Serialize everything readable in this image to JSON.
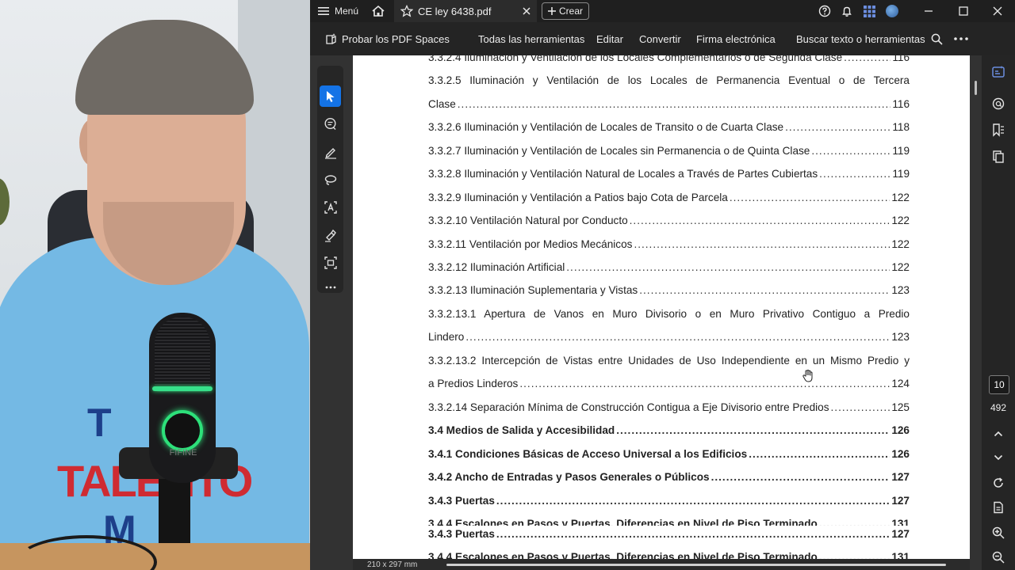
{
  "titlebar": {
    "menu_label": "Menú",
    "tab_title": "CE ley 6438.pdf",
    "create_label": "Crear"
  },
  "toolbar": {
    "spaces_label": "Probar los PDF Spaces",
    "all_tools_label": "Todas las herramientas",
    "edit_label": "Editar",
    "convert_label": "Convertir",
    "sign_label": "Firma electrónica",
    "search_label": "Buscar texto o herramientas"
  },
  "document": {
    "page_size": "210 x 297 mm",
    "toc": [
      {
        "text": "3.3.2.4 Iluminación y Ventilación de los Locales Complementarios o de Segunda Clase",
        "page": "116"
      },
      {
        "text": "3.3.2.5 Iluminación y Ventilación de los Locales de Permanencia Eventual o de Tercera"
      },
      {
        "text": "Clase",
        "page": "116"
      },
      {
        "text": "3.3.2.6 Iluminación y Ventilación de Locales de Transito o de Cuarta Clase",
        "page": "118"
      },
      {
        "text": "3.3.2.7 Iluminación y Ventilación de Locales sin Permanencia o de Quinta Clase",
        "page": "119"
      },
      {
        "text": "3.3.2.8 Iluminación y Ventilación Natural de Locales a Través de Partes Cubiertas",
        "page": "119"
      },
      {
        "text": "3.3.2.9 Iluminación y Ventilación a Patios bajo Cota de Parcela",
        "page": "122"
      },
      {
        "text": "3.3.2.10 Ventilación Natural por Conducto",
        "page": "122"
      },
      {
        "text": "3.3.2.11 Ventilación por Medios Mecánicos",
        "page": "122"
      },
      {
        "text": "3.3.2.12 Iluminación Artificial",
        "page": "122"
      },
      {
        "text": "3.3.2.13 Iluminación Suplementaria y Vistas",
        "page": "123"
      },
      {
        "text": "3.3.2.13.1 Apertura de Vanos en Muro Divisorio o en Muro Privativo Contiguo a Predio"
      },
      {
        "text": "Lindero",
        "page": "123"
      },
      {
        "text": "3.3.2.13.2 Intercepción de Vistas entre Unidades de Uso Independiente en un Mismo Predio y"
      },
      {
        "text": "a Predios Linderos",
        "page": "124"
      },
      {
        "text": "3.3.2.14 Separación Mínima de Construcción Contigua a Eje Divisorio entre Predios",
        "page": "125"
      },
      {
        "text": "3.4 Medios de Salida y Accesibilidad",
        "page": "126"
      },
      {
        "text": "3.4.1 Condiciones Básicas de Acceso Universal a los Edificios",
        "page": "126"
      },
      {
        "text": "3.4.2 Ancho de Entradas y Pasos Generales o Públicos",
        "page": "127"
      },
      {
        "text": "3.4.3 Puertas",
        "page": "127"
      },
      {
        "text": "3.4.4 Escalones en Pasos y Puertas. Diferencias en Nivel de Piso Terminado",
        "page": "131"
      },
      {
        "text": "3.4.3 Puertas",
        "page": "127"
      },
      {
        "text": "3.4.4 Escalones en Pasos y Puertas. Diferencias en Nivel de Piso Terminado",
        "page": "131"
      }
    ]
  },
  "navigation": {
    "current_page": "10",
    "total_pages": "492"
  },
  "webcam": {
    "shirt_line1": "T",
    "shirt_line2": "TALENTO",
    "shirt_line3": "M",
    "mic_brand": "FIFINE"
  },
  "colors": {
    "accent": "#1473e6",
    "mic_ring": "#2de07a",
    "shirt": "#74b9e4"
  },
  "icons": [
    "hamburger-icon",
    "home-icon",
    "star-icon",
    "close-icon",
    "plus-icon",
    "help-icon",
    "bell-icon",
    "apps-icon",
    "avatar",
    "minimize-icon",
    "maximize-icon",
    "window-close-icon",
    "spaces-icon",
    "search-icon",
    "more-icon",
    "select-icon",
    "comment-icon",
    "draw-icon",
    "lasso-icon",
    "text-recognition-icon",
    "sign-icon",
    "scan-icon",
    "ellipsis-icon",
    "ai-assistant-icon",
    "comments-icon",
    "bookmarks-icon",
    "pages-icon",
    "chevron-up-icon",
    "chevron-down-icon",
    "refresh-icon",
    "document-icon",
    "zoom-in-icon",
    "zoom-out-icon"
  ]
}
